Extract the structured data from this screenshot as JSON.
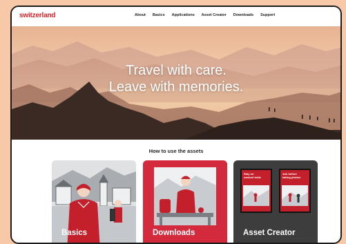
{
  "brand": {
    "logo_text": "switzerland",
    "accent": "#d8232a"
  },
  "nav": {
    "items": [
      "About",
      "Basics",
      "Applications",
      "Asset Creator",
      "Downloads",
      "Support"
    ]
  },
  "hero": {
    "line1": "Travel with care.",
    "line2": "Leave with memories."
  },
  "section": {
    "title": "How to use the assets"
  },
  "cards": [
    {
      "label": "Basics"
    },
    {
      "label": "Downloads"
    },
    {
      "label": "Asset Creator"
    }
  ],
  "posters": [
    {
      "title": "Stay on\nmarked trails"
    },
    {
      "title": "Ask before\ntaking photos"
    }
  ]
}
